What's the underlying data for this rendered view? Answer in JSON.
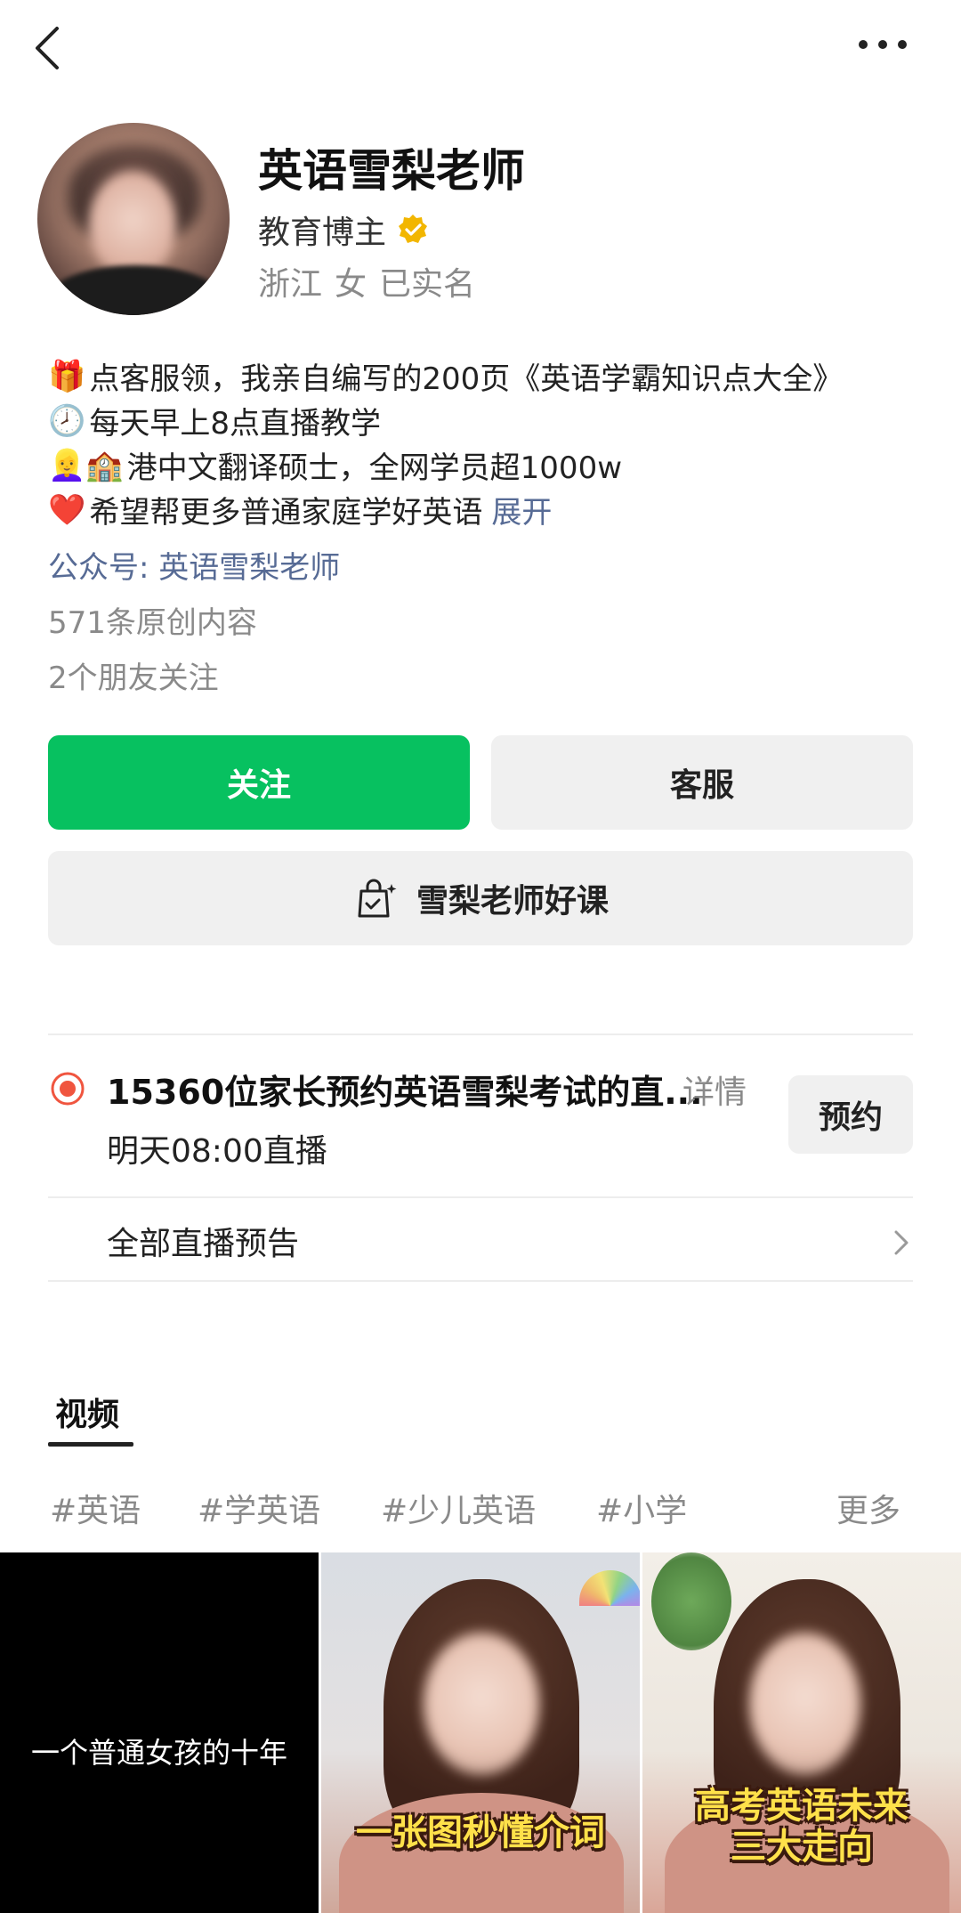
{
  "topbar": {
    "back_icon": "chevron-left-icon",
    "more_icon": "more-horizontal-icon"
  },
  "profile": {
    "name": "英语雪梨老师",
    "role": "教育博主",
    "verified_icon": "verified-badge-icon",
    "verified_color": "#f2b600",
    "meta": [
      "浙江",
      "女",
      "已实名"
    ]
  },
  "bio": {
    "lines": [
      {
        "emoji": "🎁",
        "text": "点客服领，我亲自编写的200页《英语学霸知识点大全》"
      },
      {
        "emoji": "🕗",
        "text": "每天早上8点直播教学"
      },
      {
        "emoji": "👱‍♀️🏫",
        "text": "港中文翻译硕士，全网学员超1000w"
      },
      {
        "emoji": "❤️",
        "text": "希望帮更多普通家庭学好英语"
      }
    ],
    "expand_label": "展开",
    "official_account": "公众号: 英语雪梨老师",
    "original_count": "571条原创内容",
    "friends_following": "2个朋友关注"
  },
  "actions": {
    "follow_label": "关注",
    "service_label": "客服",
    "course_label": "雪梨老师好课",
    "course_icon": "shopping-bag-icon",
    "follow_color": "#07c160"
  },
  "live": {
    "title": "15360位家长预约英语雪梨考试的直...",
    "detail_label": "详情",
    "time": "明天08:00直播",
    "reserve_label": "预约",
    "all_label": "全部直播预告",
    "live_color": "#f0553f"
  },
  "tabs": {
    "active": "视频"
  },
  "tags": {
    "items": [
      "#英语",
      "#学英语",
      "#少儿英语",
      "#小学"
    ],
    "more_label": "更多"
  },
  "videos": [
    {
      "caption": "一个普通女孩的十年"
    },
    {
      "caption": "一张图秒懂介词"
    },
    {
      "caption_line1": "高考英语未来",
      "caption_line2": "三大走向"
    }
  ]
}
